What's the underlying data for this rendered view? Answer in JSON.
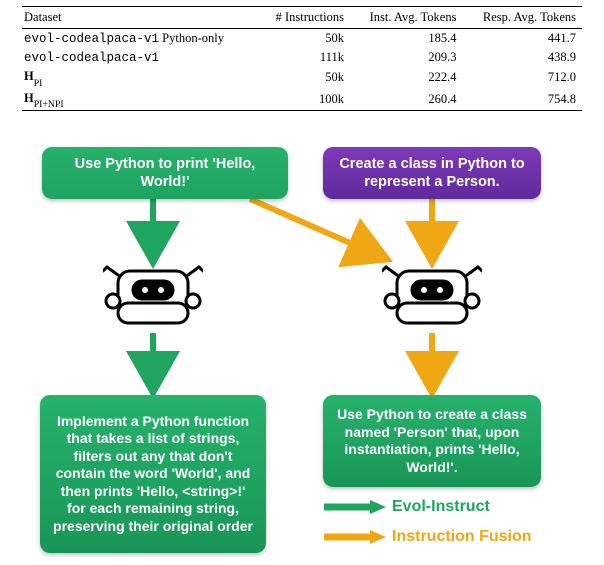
{
  "table": {
    "headers": [
      "Dataset",
      "# Instructions",
      "Inst. Avg. Tokens",
      "Resp. Avg. Tokens"
    ],
    "rows": [
      {
        "name_html": "<span class='mono'>evol-codealpaca-v1</span> Python-only",
        "c1": "50k",
        "c2": "185.4",
        "c3": "441.7"
      },
      {
        "name_html": "<span class='mono'>evol-codealpaca-v1</span>",
        "c1": "111k",
        "c2": "209.3",
        "c3": "438.9"
      },
      {
        "name_html": "<b>H</b><span class='sub'>PI</span>",
        "c1": "50k",
        "c2": "222.4",
        "c3": "712.0"
      },
      {
        "name_html": "<b>H</b><span class='sub'>PI+NPI</span>",
        "c1": "100k",
        "c2": "260.4",
        "c3": "754.8"
      }
    ]
  },
  "diagram": {
    "input_green": "Use Python to print 'Hello, World!'",
    "input_purple": "Create a class in Python to represent a Person.",
    "output_left": "Implement a Python function that takes a list of strings, filters out any that don't contain the word 'World', and then prints 'Hello, <string>!' for each remaining string, preserving their original order",
    "output_right": "Use Python to create a class named 'Person' that, upon instantiation, prints 'Hello, World!'.",
    "legend": {
      "evol": "Evol-Instruct",
      "fusion": "Instruction Fusion"
    },
    "colors": {
      "green": "#1fa55f",
      "orange": "#f0a714"
    }
  }
}
